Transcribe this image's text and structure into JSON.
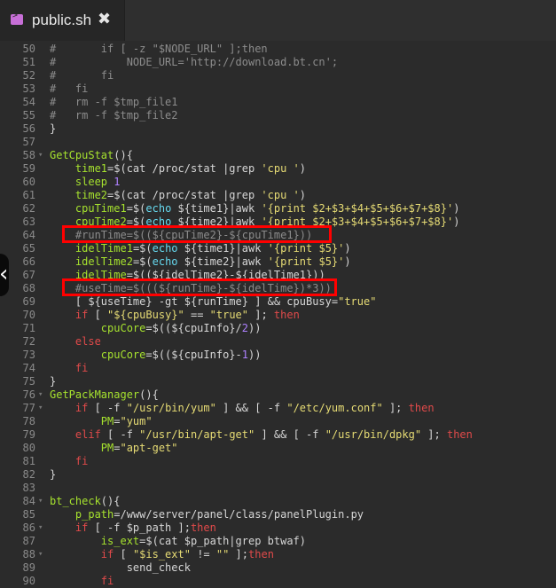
{
  "tab": {
    "title": "public.sh",
    "close_symbol": "✖",
    "icon": "terminal-file-icon"
  },
  "code_lines": [
    {
      "n": "50",
      "html": "<span class=\"cmt\">#       if [ -z \"$NODE_URL\" ];then</span>"
    },
    {
      "n": "51",
      "html": "<span class=\"cmt\">#           NODE_URL='http://download.bt.cn';</span>"
    },
    {
      "n": "52",
      "html": "<span class=\"cmt\">#       fi</span>"
    },
    {
      "n": "53",
      "html": "<span class=\"cmt\">#   fi</span>"
    },
    {
      "n": "54",
      "html": "<span class=\"cmt\">#   rm -f $tmp_file1</span>"
    },
    {
      "n": "55",
      "html": "<span class=\"cmt\">#   rm -f $tmp_file2</span>"
    },
    {
      "n": "56",
      "html": "}"
    },
    {
      "n": "57",
      "html": ""
    },
    {
      "n": "58",
      "html": "<span class=\"fn\">GetCpuStat</span>(){"
    },
    {
      "n": "59",
      "html": "    <span class=\"fn\">time1</span>=$(cat /proc/stat |grep <span class=\"str\">'cpu '</span>)"
    },
    {
      "n": "60",
      "html": "    <span class=\"fn\">sleep</span> <span class=\"num\">1</span>"
    },
    {
      "n": "61",
      "html": "    <span class=\"fn\">time2</span>=$(cat /proc/stat |grep <span class=\"str\">'cpu '</span>)"
    },
    {
      "n": "62",
      "html": "    <span class=\"fn\">cpuTime1</span>=$(<span class=\"var\">echo</span> ${time1}|awk <span class=\"str\">'{print $2+$3+$4+$5+$6+$7+$8}'</span>)"
    },
    {
      "n": "63",
      "html": "    <span class=\"fn\">cpuTime2</span>=$(<span class=\"var\">echo</span> ${time2}|awk <span class=\"str\">'{print $2+$3+$4+$5+$6+$7+$8}'</span>)"
    },
    {
      "n": "64",
      "html": "    <span class=\"cmt\">#runTime=$((${cpuTime2}-${cpuTime1}))</span>"
    },
    {
      "n": "65",
      "html": "    <span class=\"fn\">idelTime1</span>=$(<span class=\"var\">echo</span> ${time1}|awk <span class=\"str\">'{print $5}'</span>)"
    },
    {
      "n": "66",
      "html": "    <span class=\"fn\">idelTime2</span>=$(<span class=\"var\">echo</span> ${time2}|awk <span class=\"str\">'{print $5}'</span>)"
    },
    {
      "n": "67",
      "html": "    <span class=\"fn\">idelTime</span>=$((${idelTime2}-${idelTime1}))"
    },
    {
      "n": "68",
      "html": "    <span class=\"cmt\">#useTime=$(((${runTime}-${idelTime})*3))</span>"
    },
    {
      "n": "69",
      "html": "    [ ${useTime} -gt ${runTime} ] && cpuBusy=<span class=\"str\">\"true\"</span>"
    },
    {
      "n": "70",
      "html": "    <span class=\"kw\">if</span> [ <span class=\"str\">\"${cpuBusy}\"</span> == <span class=\"str\">\"true\"</span> ]; <span class=\"kw\">then</span>"
    },
    {
      "n": "71",
      "html": "        <span class=\"fn\">cpuCore</span>=$((${cpuInfo}/<span class=\"num\">2</span>))"
    },
    {
      "n": "72",
      "html": "    <span class=\"kw\">else</span>"
    },
    {
      "n": "73",
      "html": "        <span class=\"fn\">cpuCore</span>=$((${cpuInfo}-<span class=\"num\">1</span>))"
    },
    {
      "n": "74",
      "html": "    <span class=\"kw\">fi</span>"
    },
    {
      "n": "75",
      "html": "}"
    },
    {
      "n": "76",
      "html": "<span class=\"fn\">GetPackManager</span>(){"
    },
    {
      "n": "77",
      "html": "    <span class=\"kw\">if</span> [ -f <span class=\"str\">\"/usr/bin/yum\"</span> ] && [ -f <span class=\"str\">\"/etc/yum.conf\"</span> ]; <span class=\"kw\">then</span>"
    },
    {
      "n": "78",
      "html": "        <span class=\"fn\">PM</span>=<span class=\"str\">\"yum\"</span>"
    },
    {
      "n": "79",
      "html": "    <span class=\"kw\">elif</span> [ -f <span class=\"str\">\"/usr/bin/apt-get\"</span> ] && [ -f <span class=\"str\">\"/usr/bin/dpkg\"</span> ]; <span class=\"kw\">then</span>"
    },
    {
      "n": "80",
      "html": "        <span class=\"fn\">PM</span>=<span class=\"str\">\"apt-get\"</span>"
    },
    {
      "n": "81",
      "html": "    <span class=\"kw\">fi</span>"
    },
    {
      "n": "82",
      "html": "}"
    },
    {
      "n": "83",
      "html": ""
    },
    {
      "n": "84",
      "html": "<span class=\"fn\">bt_check</span>(){"
    },
    {
      "n": "85",
      "html": "    <span class=\"fn\">p_path</span>=/www/server/panel/class/panelPlugin.py"
    },
    {
      "n": "86",
      "html": "    <span class=\"kw\">if</span> [ -f $p_path ];<span class=\"kw\">then</span>"
    },
    {
      "n": "87",
      "html": "        <span class=\"fn\">is_ext</span>=$(cat $p_path|grep btwaf)"
    },
    {
      "n": "88",
      "html": "        <span class=\"kw\">if</span> [ <span class=\"str\">\"$is_ext\"</span> != <span class=\"str\">\"\"</span> ];<span class=\"kw\">then</span>"
    },
    {
      "n": "89",
      "html": "            send_check"
    },
    {
      "n": "90",
      "html": "        <span class=\"kw\">fi</span>"
    }
  ]
}
